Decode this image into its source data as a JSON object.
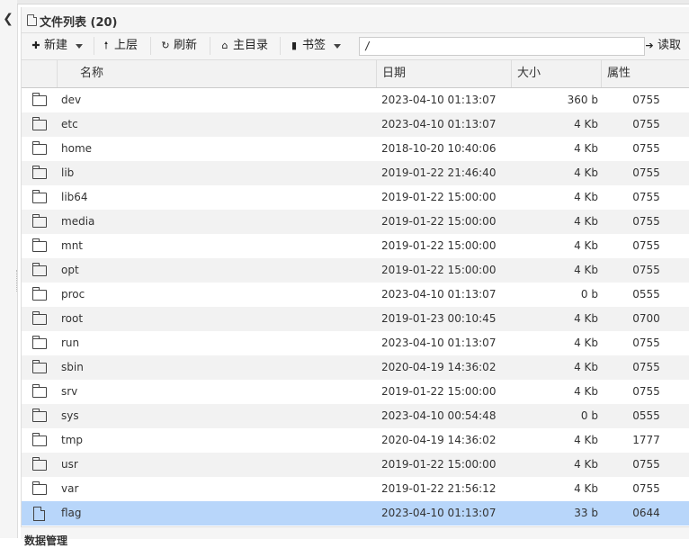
{
  "panel": {
    "title": "文件列表 (20)"
  },
  "toolbar": {
    "new_label": "新建",
    "up_label": "上层",
    "refresh_label": "刷新",
    "home_label": "主目录",
    "bookmark_label": "书签",
    "path_value": "/",
    "read_label": "读取"
  },
  "grid": {
    "columns": {
      "name": "名称",
      "date": "日期",
      "size": "大小",
      "attr": "属性"
    },
    "rows": [
      {
        "type": "folder",
        "name": "dev",
        "date": "2023-04-10 01:13:07",
        "size": "360 b",
        "attr": "0755"
      },
      {
        "type": "folder",
        "name": "etc",
        "date": "2023-04-10 01:13:07",
        "size": "4 Kb",
        "attr": "0755"
      },
      {
        "type": "folder",
        "name": "home",
        "date": "2018-10-20 10:40:06",
        "size": "4 Kb",
        "attr": "0755"
      },
      {
        "type": "folder",
        "name": "lib",
        "date": "2019-01-22 21:46:40",
        "size": "4 Kb",
        "attr": "0755"
      },
      {
        "type": "folder",
        "name": "lib64",
        "date": "2019-01-22 15:00:00",
        "size": "4 Kb",
        "attr": "0755"
      },
      {
        "type": "folder",
        "name": "media",
        "date": "2019-01-22 15:00:00",
        "size": "4 Kb",
        "attr": "0755"
      },
      {
        "type": "folder",
        "name": "mnt",
        "date": "2019-01-22 15:00:00",
        "size": "4 Kb",
        "attr": "0755"
      },
      {
        "type": "folder",
        "name": "opt",
        "date": "2019-01-22 15:00:00",
        "size": "4 Kb",
        "attr": "0755"
      },
      {
        "type": "folder",
        "name": "proc",
        "date": "2023-04-10 01:13:07",
        "size": "0 b",
        "attr": "0555"
      },
      {
        "type": "folder",
        "name": "root",
        "date": "2019-01-23 00:10:45",
        "size": "4 Kb",
        "attr": "0700"
      },
      {
        "type": "folder",
        "name": "run",
        "date": "2023-04-10 01:13:07",
        "size": "4 Kb",
        "attr": "0755"
      },
      {
        "type": "folder",
        "name": "sbin",
        "date": "2020-04-19 14:36:02",
        "size": "4 Kb",
        "attr": "0755"
      },
      {
        "type": "folder",
        "name": "srv",
        "date": "2019-01-22 15:00:00",
        "size": "4 Kb",
        "attr": "0755"
      },
      {
        "type": "folder",
        "name": "sys",
        "date": "2023-04-10 00:54:48",
        "size": "0 b",
        "attr": "0555"
      },
      {
        "type": "folder",
        "name": "tmp",
        "date": "2020-04-19 14:36:02",
        "size": "4 Kb",
        "attr": "1777"
      },
      {
        "type": "folder",
        "name": "usr",
        "date": "2019-01-22 15:00:00",
        "size": "4 Kb",
        "attr": "0755"
      },
      {
        "type": "folder",
        "name": "var",
        "date": "2019-01-22 21:56:12",
        "size": "4 Kb",
        "attr": "0755"
      },
      {
        "type": "file",
        "name": "flag",
        "date": "2023-04-10 01:13:07",
        "size": "33 b",
        "attr": "0644",
        "selected": true
      }
    ]
  },
  "footer": {
    "title": "数据管理"
  },
  "icons": {
    "collapse": "chevron-left-icon",
    "panel": "file-icon",
    "new": "plus-circle-icon",
    "up": "arrow-up-icon",
    "refresh": "refresh-icon",
    "home": "home-icon",
    "bookmark": "bookmark-icon",
    "read": "arrow-right-icon",
    "folder": "folder-icon",
    "file": "file-icon"
  },
  "colors": {
    "selected_row": "#b8d6fa",
    "stripe_row": "#f2f2f2",
    "toolbar_bg": "#f5f5f5"
  }
}
